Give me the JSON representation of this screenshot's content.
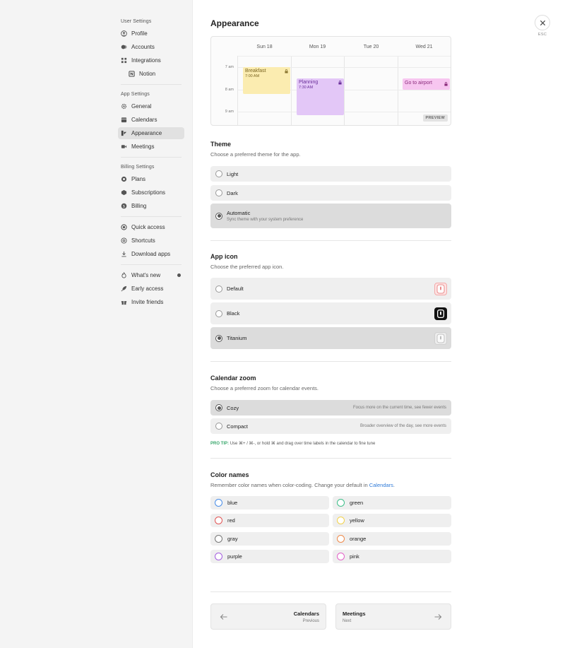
{
  "sidebar": {
    "user_settings_label": "User Settings",
    "user_items": [
      {
        "label": "Profile",
        "icon": "user-icon"
      },
      {
        "label": "Accounts",
        "icon": "accounts-icon"
      },
      {
        "label": "Integrations",
        "icon": "grid-icon"
      },
      {
        "label": "Notion",
        "icon": "notion-icon"
      }
    ],
    "app_settings_label": "App Settings",
    "app_items": [
      {
        "label": "General",
        "icon": "gear-icon"
      },
      {
        "label": "Calendars",
        "icon": "calendar-icon"
      },
      {
        "label": "Appearance",
        "icon": "appearance-icon",
        "active": true
      },
      {
        "label": "Meetings",
        "icon": "video-icon"
      }
    ],
    "billing_settings_label": "Billing Settings",
    "billing_items": [
      {
        "label": "Plans",
        "icon": "plans-icon"
      },
      {
        "label": "Subscriptions",
        "icon": "subscriptions-icon"
      },
      {
        "label": "Billing",
        "icon": "dollar-icon"
      }
    ],
    "misc_items": [
      {
        "label": "Quick access",
        "icon": "quick-access-icon"
      },
      {
        "label": "Shortcuts",
        "icon": "at-icon"
      },
      {
        "label": "Download apps",
        "icon": "download-icon"
      }
    ],
    "extra_items": [
      {
        "label": "What's new",
        "icon": "flame-icon"
      },
      {
        "label": "Early access",
        "icon": "rocket-icon"
      },
      {
        "label": "Invite friends",
        "icon": "gift-icon"
      }
    ]
  },
  "close": {
    "esc_label": "ESC"
  },
  "page": {
    "title": "Appearance"
  },
  "preview": {
    "days": [
      "Sun 18",
      "Mon 19",
      "Tue 20",
      "Wed 21"
    ],
    "times": [
      "7 am",
      "8 am",
      "9 am"
    ],
    "events": [
      {
        "title": "Breakfast",
        "time": "7:00 AM"
      },
      {
        "title": "Planning",
        "time": "7:30 AM"
      },
      {
        "title": "Go to airport"
      }
    ],
    "badge": "PREVIEW"
  },
  "theme": {
    "title": "Theme",
    "subtitle": "Choose a preferred theme for the app.",
    "options": [
      {
        "label": "Light"
      },
      {
        "label": "Dark"
      },
      {
        "label": "Automatic",
        "sub": "Sync theme with your system preference",
        "selected": true
      }
    ]
  },
  "app_icon": {
    "title": "App icon",
    "subtitle": "Choose the preferred app icon.",
    "options": [
      {
        "label": "Default"
      },
      {
        "label": "Black"
      },
      {
        "label": "Titanium",
        "selected": true
      }
    ]
  },
  "zoom": {
    "title": "Calendar zoom",
    "subtitle": "Choose a preferred zoom for calendar events.",
    "options": [
      {
        "label": "Cozy",
        "desc": "Focus more on the current time, see fewer events",
        "selected": true
      },
      {
        "label": "Compact",
        "desc": "Broader overview of the day, see more events"
      }
    ],
    "protip_label": "PRO TIP:",
    "protip_text": "Use ⌘+ / ⌘-, or hold ⌘ and drag over time labels in the calendar to fine tune"
  },
  "color_names": {
    "title": "Color names",
    "subtitle_pre": "Remember color names when color-coding. Change your default in",
    "subtitle_link": "Calendars",
    "subtitle_post": ".",
    "colors": [
      {
        "name": "blue",
        "hex": "#4a8ee8"
      },
      {
        "name": "green",
        "hex": "#3fbf8a"
      },
      {
        "name": "red",
        "hex": "#e25555"
      },
      {
        "name": "yellow",
        "hex": "#f2d24b"
      },
      {
        "name": "gray",
        "hex": "#777777"
      },
      {
        "name": "orange",
        "hex": "#ef8a4a"
      },
      {
        "name": "purple",
        "hex": "#a55ee0"
      },
      {
        "name": "pink",
        "hex": "#e361c8"
      }
    ]
  },
  "nav": {
    "prev_label": "Calendars",
    "prev_sub": "Previous",
    "next_label": "Meetings",
    "next_sub": "Next"
  }
}
